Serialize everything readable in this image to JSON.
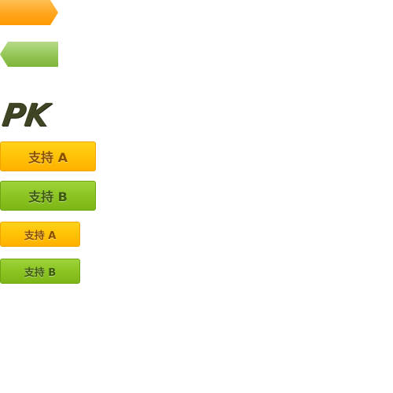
{
  "logo": {
    "text": "PK"
  },
  "buttons": {
    "support_a_large": "支持 A",
    "support_b_large": "支持 B",
    "support_a_small": "支持 A",
    "support_b_small": "支持 B"
  },
  "colors": {
    "orange": "#ffaa10",
    "green": "#8cc522",
    "logo": "#3f4424"
  }
}
